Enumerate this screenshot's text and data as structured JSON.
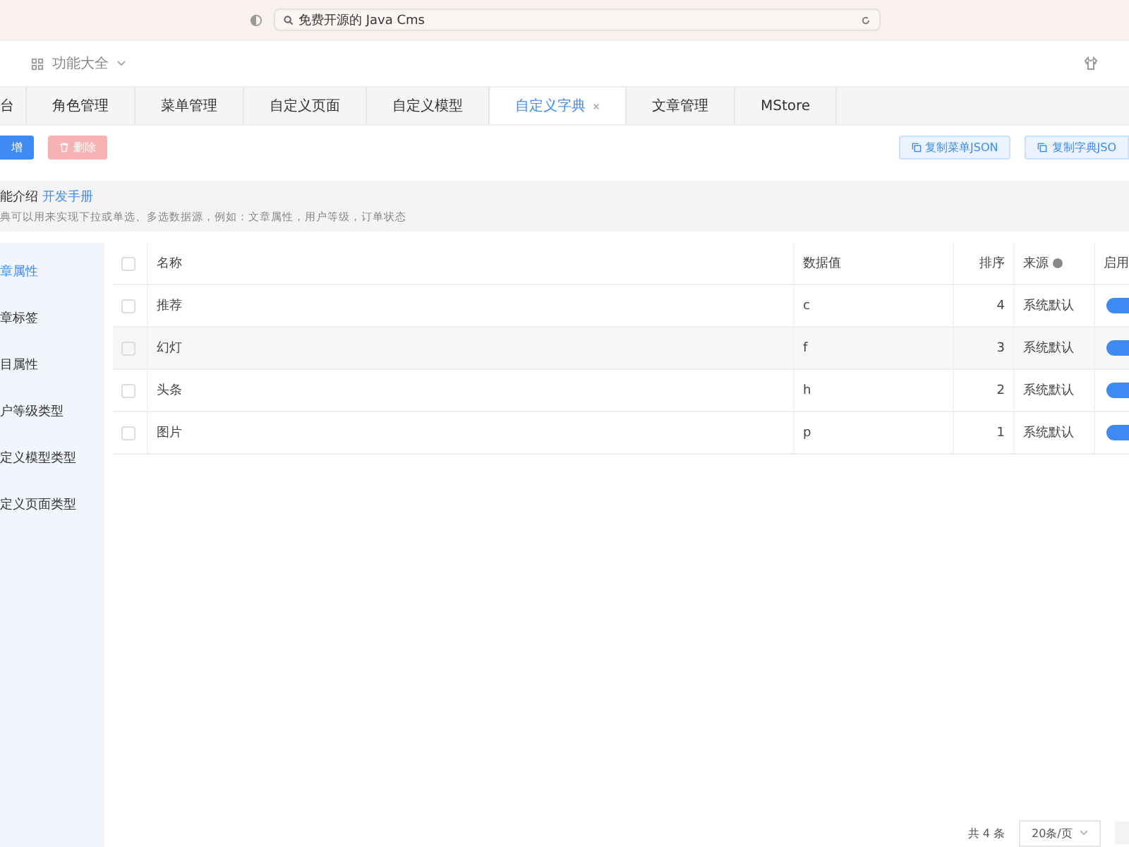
{
  "browser": {
    "address": "免费开源的 Java Cms"
  },
  "header": {
    "menu": "功能大全"
  },
  "tabs": [
    {
      "label": "台",
      "selected": false,
      "closable": false
    },
    {
      "label": "角色管理",
      "selected": false,
      "closable": false
    },
    {
      "label": "菜单管理",
      "selected": false,
      "closable": false
    },
    {
      "label": "自定义页面",
      "selected": false,
      "closable": false
    },
    {
      "label": "自定义模型",
      "selected": false,
      "closable": false
    },
    {
      "label": "自定义字典",
      "selected": true,
      "closable": true
    },
    {
      "label": "文章管理",
      "selected": false,
      "closable": false
    },
    {
      "label": "MStore",
      "selected": false,
      "closable": false
    }
  ],
  "toolbar": {
    "add": "增",
    "delete": "删除",
    "copy_menu": "复制菜单JSON",
    "copy_dict": "复制字典JSO"
  },
  "info": {
    "title": "能介绍",
    "link": "开发手册",
    "description": "典可以用来实现下拉或单选、多选数据源，例如：文章属性，用户等级，订单状态"
  },
  "sidebar": [
    {
      "label": "章属性",
      "selected": true
    },
    {
      "label": "章标签",
      "selected": false
    },
    {
      "label": "目属性",
      "selected": false
    },
    {
      "label": "户等级类型",
      "selected": false
    },
    {
      "label": "定义模型类型",
      "selected": false
    },
    {
      "label": "定义页面类型",
      "selected": false
    }
  ],
  "table": {
    "all_checked": false,
    "columns": [
      "名称",
      "数据值",
      "排序",
      "来源",
      "启用"
    ],
    "rows": [
      {
        "name": "推荐",
        "value": "c",
        "order": "4",
        "source": "系统默认",
        "enabled": true,
        "checked": false
      },
      {
        "name": "幻灯",
        "value": "f",
        "order": "3",
        "source": "系统默认",
        "enabled": true,
        "checked": false
      },
      {
        "name": "头条",
        "value": "h",
        "order": "2",
        "source": "系统默认",
        "enabled": true,
        "checked": false
      },
      {
        "name": "图片",
        "value": "p",
        "order": "1",
        "source": "系统默认",
        "enabled": true,
        "checked": false
      }
    ]
  },
  "pagination": {
    "total": "共 4 条",
    "page_size": "20条/页"
  }
}
